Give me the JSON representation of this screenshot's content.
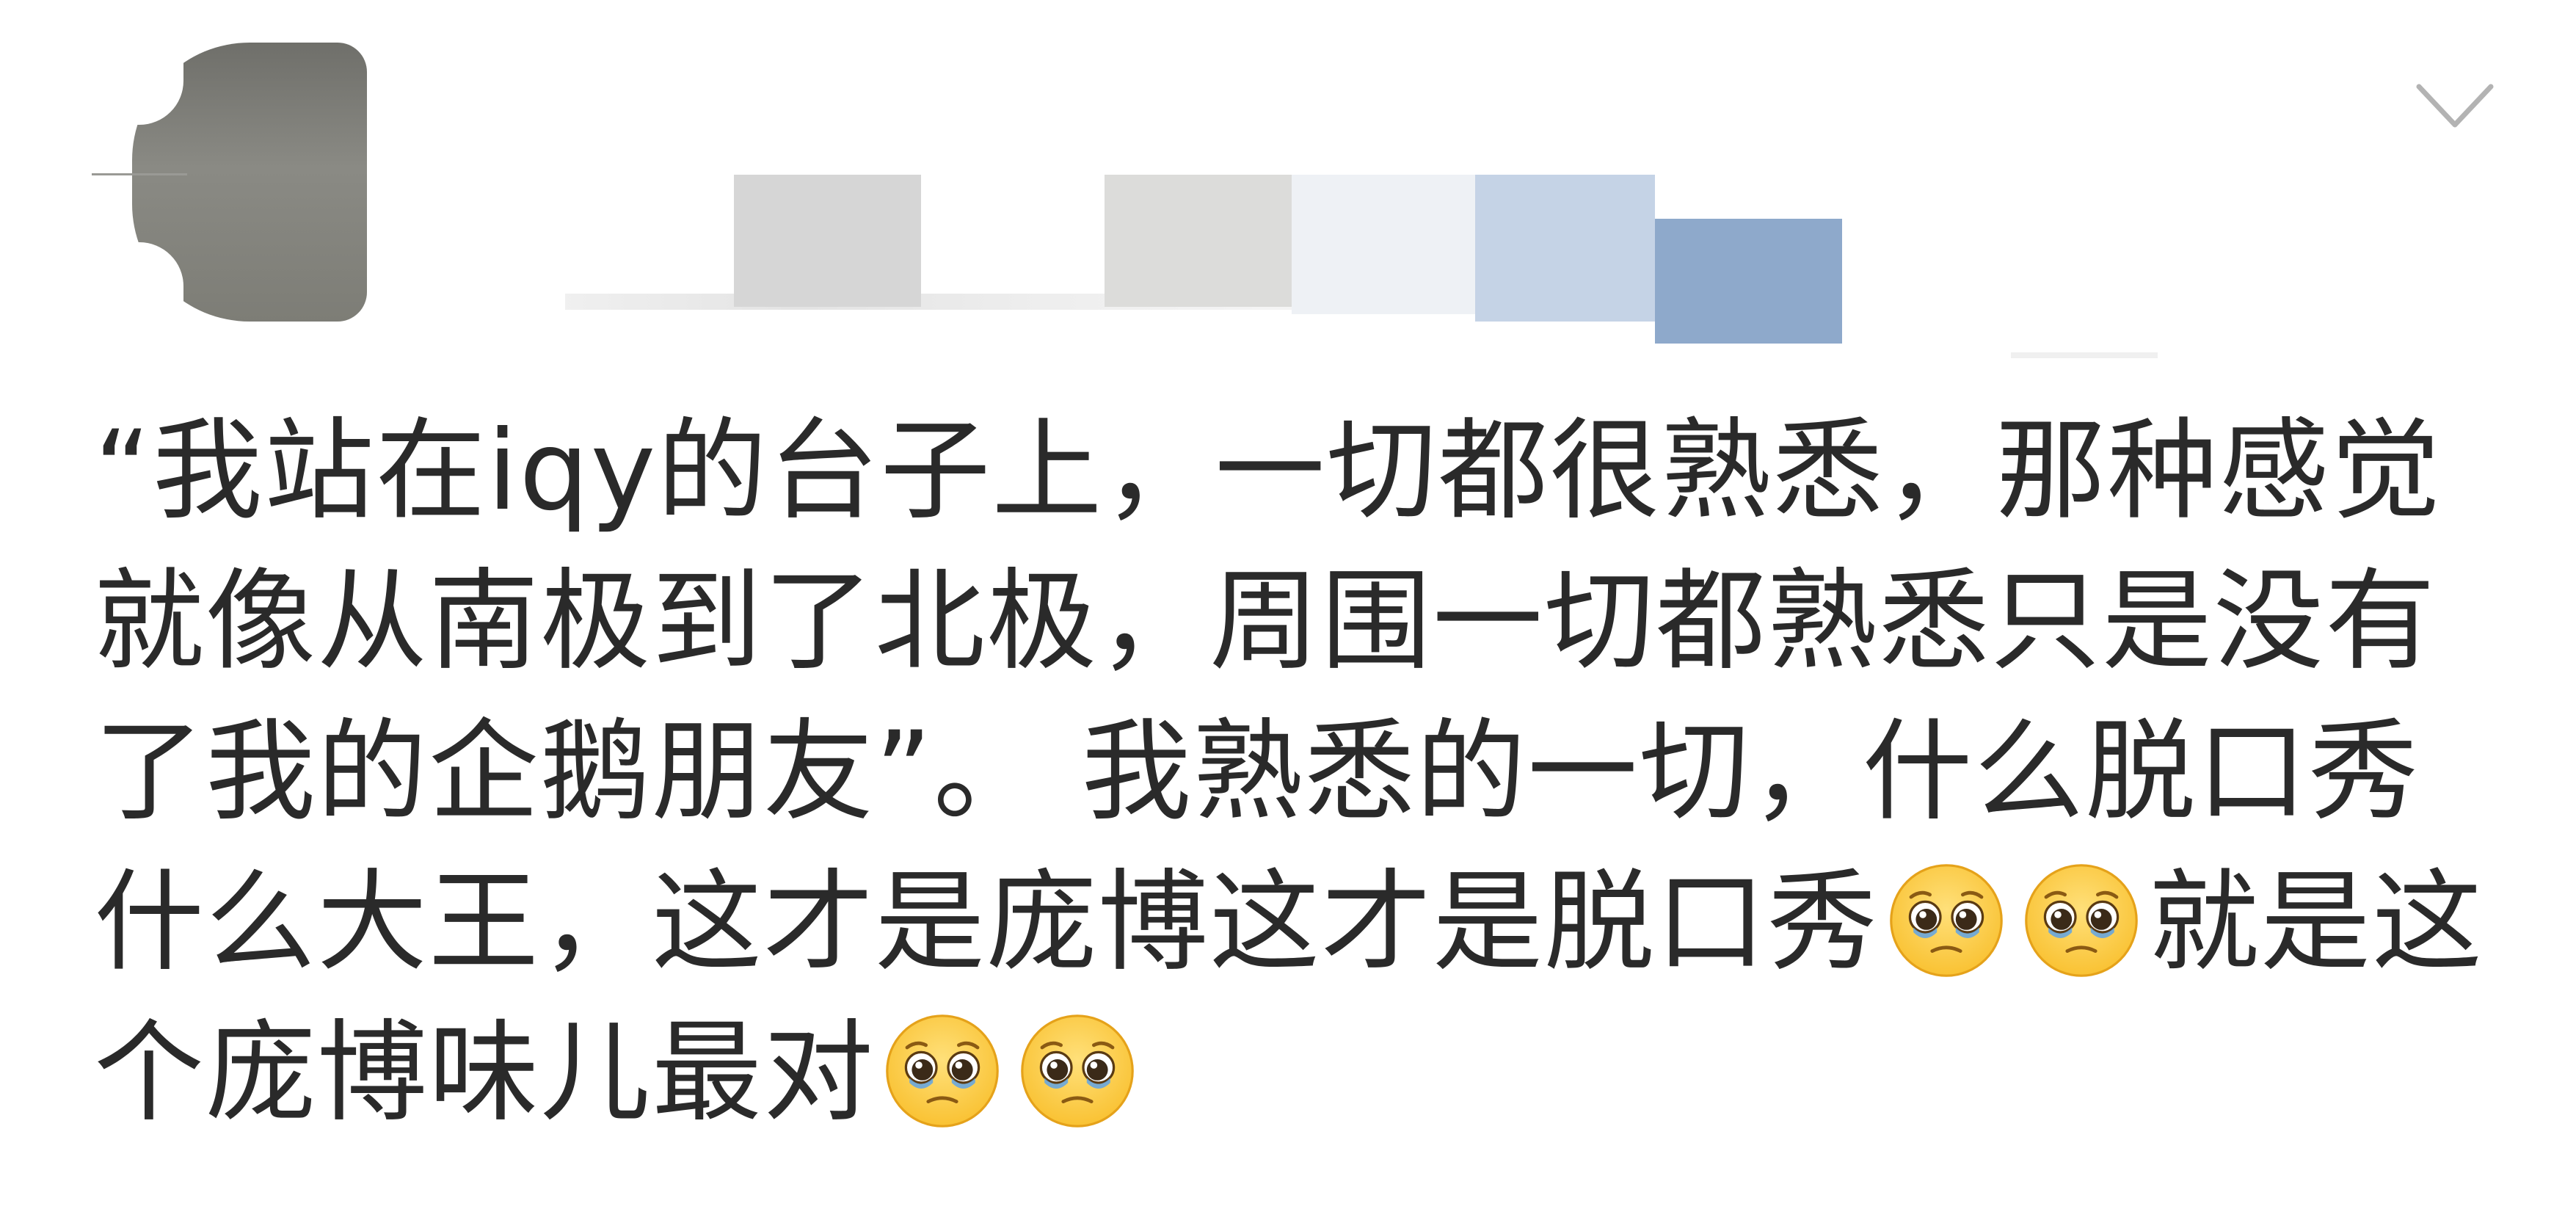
{
  "comment": {
    "segments": [
      {
        "type": "text",
        "value": "“我站在iqy的台子上，一切都很熟悉，那种感觉就像从南极到了北极，周围一切都熟悉只是没有了我的企鹅朋友”。 我熟悉的一切，什么脱口秀什么大王，这才是庞博这才是脱口秀"
      },
      {
        "type": "emoji",
        "name": "pleading-face-icon"
      },
      {
        "type": "emoji",
        "name": "pleading-face-icon"
      },
      {
        "type": "text",
        "value": "就是这个庞博味儿最对"
      },
      {
        "type": "emoji",
        "name": "pleading-face-icon"
      },
      {
        "type": "emoji",
        "name": "pleading-face-icon"
      }
    ]
  },
  "header": {
    "avatar_icon": "avatar",
    "menu_icon": "chevron-down-icon"
  },
  "colors": {
    "text": "#2a2a2a",
    "chevron": "#b3b3b3",
    "emoji_face": "#f9c233",
    "emoji_tear": "#5fa3e6"
  }
}
